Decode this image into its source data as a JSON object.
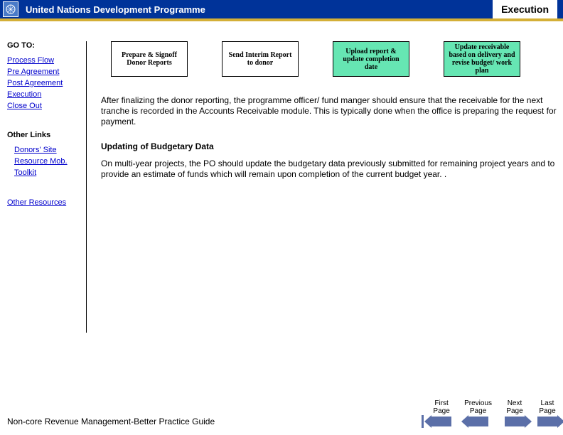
{
  "header": {
    "org": "United Nations Development Programme",
    "page_label": "Execution"
  },
  "sidebar": {
    "goto_heading": "GO TO:",
    "goto_links": [
      "Process Flow",
      "Pre Agreement",
      "Post Agreement",
      "Execution",
      "Close Out"
    ],
    "other_links_heading": "Other Links",
    "other_links": [
      "Donors' Site",
      "Resource Mob.",
      "  Toolkit"
    ],
    "other_resources": "Other Resources"
  },
  "flow": {
    "items": [
      {
        "text": "Prepare & Signoff Donor Reports",
        "highlight": false
      },
      {
        "text": "Send Interim Report to donor",
        "highlight": false
      },
      {
        "text": "Upload report & update completion date",
        "highlight": true
      },
      {
        "text": "Update receivable based on delivery and revise budget/ work plan",
        "highlight": true
      }
    ]
  },
  "body": {
    "para1": "After finalizing the donor reporting, the programme officer/ fund manger should ensure that the receivable for the next tranche is recorded in the Accounts Receivable module.  This is typically done when the office is preparing the request for payment.",
    "subhead": "Updating of Budgetary Data",
    "para2": "On multi-year projects, the PO should update the budgetary data previously submitted for remaining project years and to provide an estimate of funds which will remain upon completion of the current budget year. ."
  },
  "footer": {
    "title": "Non-core Revenue Management-Better Practice Guide",
    "nav": {
      "first": "First\nPage",
      "prev": "Previous\nPage",
      "next": "Next\nPage",
      "last": "Last\nPage"
    }
  }
}
